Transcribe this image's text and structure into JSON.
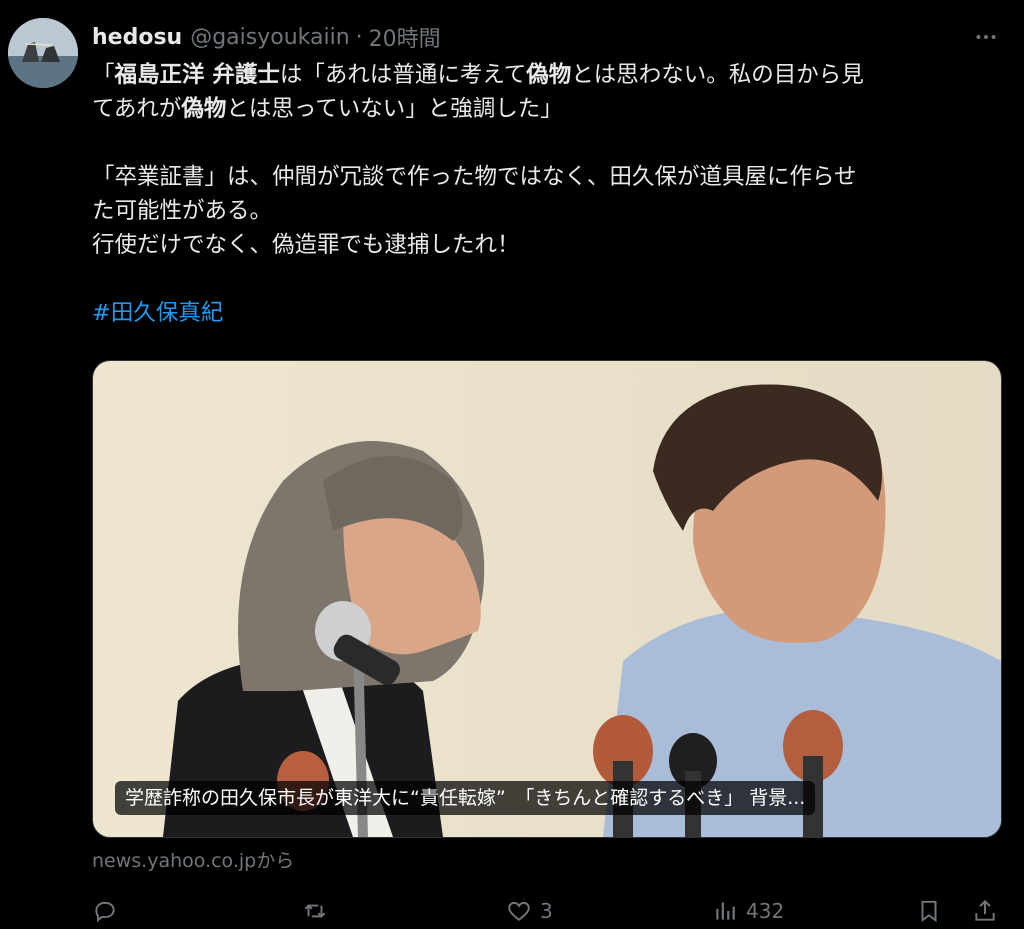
{
  "tweet": {
    "author_name": "hedosu",
    "author_handle": "@gaisyoukaiin",
    "separator": "·",
    "time": "20時間",
    "avatar_icon": "avatar-rocks-sea",
    "more_icon": "more-dots-icon",
    "lines": {
      "l1_a": "「",
      "l1_b": "福島正洋 弁護士",
      "l1_c": "は「あれは普通に考えて",
      "l1_d": "偽物",
      "l1_e": "とは思わない。私の目から見",
      "l2_a": "てあれが",
      "l2_b": "偽物",
      "l2_c": "とは思っていない」と強調した」",
      "p2_l1": "「卒業証書」は、仲間が冗談で作った物ではなく、田久保が道具屋に作らせ",
      "p2_l2": "た可能性がある。",
      "p2_l3": "行使だけでなく、偽造罪でも逮捕したれ！"
    },
    "hashtag": "#田久保真紀"
  },
  "card": {
    "caption": "学歴詐称の田久保市長が東洋大に“責任転嫁”　「きちんと確認するべき」 背景...",
    "source": "news.yahoo.co.jpから"
  },
  "actions": {
    "reply_icon": "reply-icon",
    "retweet_icon": "retweet-icon",
    "like_icon": "heart-icon",
    "like_count": "3",
    "views_icon": "views-icon",
    "views_count": "432",
    "bookmark_icon": "bookmark-icon",
    "share_icon": "share-icon"
  },
  "colors": {
    "background": "#000000",
    "text": "#e7e9ea",
    "muted": "#71767b",
    "link": "#1d9bf0"
  }
}
